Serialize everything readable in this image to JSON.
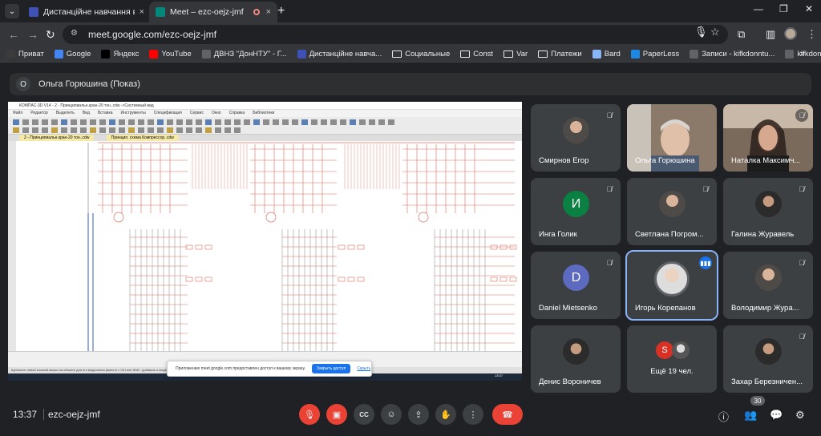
{
  "browser": {
    "tabs": [
      {
        "title": "Дистанційне навчання в ВСП",
        "close": "×",
        "active": false
      },
      {
        "title": "Meet – ezc-oejz-jmf",
        "close": "×",
        "active": true
      }
    ],
    "new_tab": "+",
    "url": "meet.google.com/ezc-oejz-jmf",
    "bookmarks": [
      {
        "label": "Приват",
        "icon": "privat-icon",
        "color": "#3b3b3b"
      },
      {
        "label": "Google",
        "icon": "google-icon",
        "color": "#4285f4"
      },
      {
        "label": "Яндекс",
        "icon": "yandex-icon",
        "color": "#000000"
      },
      {
        "label": "YouTube",
        "icon": "youtube-icon",
        "color": "#ff0000"
      },
      {
        "label": "ДВНЗ \"ДонНТУ\" - Г...",
        "icon": "page-icon",
        "color": "#5f6368"
      },
      {
        "label": "Дистанційне навча...",
        "icon": "classroom-icon",
        "color": "#3f51b5"
      },
      {
        "label": "Социальные",
        "icon": "folder-icon",
        "folder": true
      },
      {
        "label": "Const",
        "icon": "folder-icon",
        "folder": true
      },
      {
        "label": "Var",
        "icon": "folder-icon",
        "folder": true
      },
      {
        "label": "Платежи",
        "icon": "folder-icon",
        "folder": true
      },
      {
        "label": "Bard",
        "icon": "bard-icon",
        "color": "#8ab4f8"
      },
      {
        "label": "PaperLess",
        "icon": "paperless-icon",
        "color": "#1e88e5"
      },
      {
        "label": "Записи - kifkdonntu...",
        "icon": "page-icon",
        "color": "#5f6368"
      },
      {
        "label": "kifkdonntu.com.ua",
        "icon": "page-icon",
        "color": "#5f6368"
      }
    ],
    "bookmarks_more": "»"
  },
  "meet": {
    "presenter_initial": "О",
    "presenter_label": "Ольга Горюшина (Показ)",
    "presentation": {
      "window_title": "КОМПАС-3D V14 - 2 - Принципиальн.кран-20 тон..cdw ->Системный вид",
      "menu": [
        "Файл",
        "Редактор",
        "Выделить",
        "Вид",
        "Вставка",
        "Инструменты",
        "Спецификация",
        "Сервис",
        "Окно",
        "Справка",
        "Библиотеки"
      ],
      "doc_tabs": [
        "2 - Принципиальн.кран-20 тон..cdw",
        "Принцип. схема Компрессор..cdw"
      ],
      "status_hint": "Щелкните левой кнопкой мыши на объекте для его выделения (вместе с Ctrl или Shift - добавить к выделенным)",
      "notice_text": "Приложению meet.google.com предоставлен доступ к вашему экрану.",
      "notice_button": "Закрыть доступ",
      "notice_link": "Скрыть",
      "tray_time": "13:37",
      "tray_date": "19.03.2024",
      "tray_lang": "УКР"
    },
    "participants": [
      {
        "name": "Смирнов Егор",
        "type": "photo",
        "muted": true
      },
      {
        "name": "Ольга Горюшина",
        "type": "video",
        "muted": false
      },
      {
        "name": "Наталка Максимч...",
        "type": "video",
        "muted": true
      },
      {
        "name": "Инга Голик",
        "type": "initial",
        "initial": "И",
        "color": "#0b8043",
        "muted": true
      },
      {
        "name": "Светлана Погром...",
        "type": "photo",
        "muted": true
      },
      {
        "name": "Галина Журавель",
        "type": "photo",
        "muted": true
      },
      {
        "name": "Daniel Mietsenko",
        "type": "initial",
        "initial": "D",
        "color": "#5c6bc0",
        "muted": true
      },
      {
        "name": "Игорь Корепанов",
        "type": "photo",
        "speaking": true
      },
      {
        "name": "Володимир Жура...",
        "type": "photo",
        "muted": true
      },
      {
        "name": "Денис Вороничев",
        "type": "photo",
        "muted": false
      },
      {
        "name": "Ещё 19 чел.",
        "type": "more",
        "initial": "S",
        "muted": false
      },
      {
        "name": "Захар Березничен...",
        "type": "photo",
        "muted": true
      }
    ],
    "bottom": {
      "time": "13:37",
      "meeting_code": "ezc-oejz-jmf",
      "participant_count": "30",
      "cc_label": "CC"
    }
  }
}
